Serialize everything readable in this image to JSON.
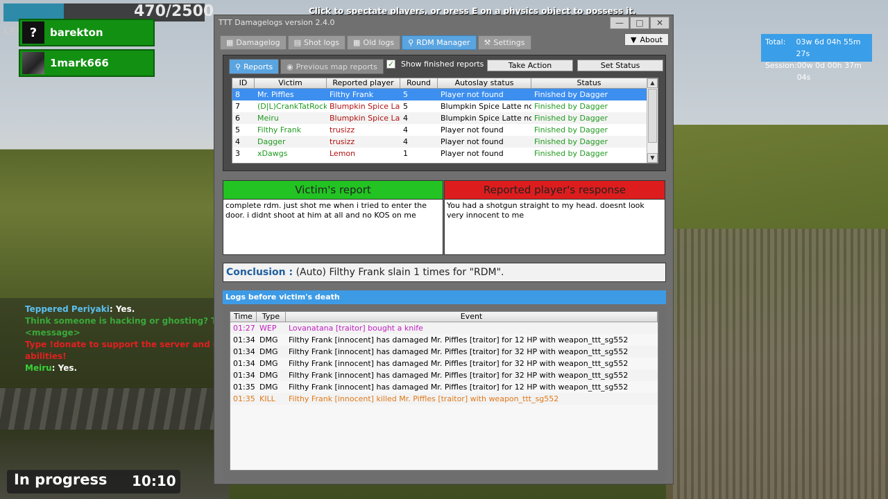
{
  "hud": {
    "ammo": "470/2500",
    "level_label": "LEV",
    "spectate_msg": "Click to spectate players, or press E on a physics object to possess it.",
    "health_fraction": 0.3
  },
  "players": [
    {
      "name": "barekton",
      "avatar": "?"
    },
    {
      "name": "1mark666",
      "avatar": ""
    }
  ],
  "chat": [
    {
      "name": "Teppered Periyaki",
      "name_color": "#5bc0f0",
      "text": ": Yes.",
      "text_color": "#ffffff"
    },
    {
      "name": "",
      "name_color": "#3aa83a",
      "text": "Think someone is hacking or ghosting? Ty",
      "text_color": "#3aa83a"
    },
    {
      "name": "",
      "name_color": "#3aa83a",
      "text": "<message>",
      "text_color": "#3aa83a"
    },
    {
      "name": "",
      "name_color": "#e02020",
      "text": "Type !donate to support the server and g",
      "text_color": "#e02020"
    },
    {
      "name": "",
      "name_color": "#e02020",
      "text": "abilities!",
      "text_color": "#e02020"
    },
    {
      "name": "Meiru",
      "name_color": "#3ad03a",
      "text": ": Yes.",
      "text_color": "#ffffff"
    }
  ],
  "round": {
    "state": "In progress",
    "timer": "10:10"
  },
  "timebox": {
    "total_label": "Total:",
    "total": "03w 6d 04h 55m 27s",
    "session_label": "Session:",
    "session": "00w 0d 00h 37m 04s"
  },
  "window": {
    "title": "TTT Damagelogs version 2.4.0",
    "about": "About",
    "tabs": [
      {
        "label": "Damagelog",
        "icon": "table-icon"
      },
      {
        "label": "Shot logs",
        "icon": "document-icon"
      },
      {
        "label": "Old logs",
        "icon": "calendar-icon"
      },
      {
        "label": "RDM Manager",
        "icon": "magnifier-icon"
      },
      {
        "label": "Settings",
        "icon": "wrench-icon"
      }
    ],
    "active_tab": 3
  },
  "rdm": {
    "subtabs": [
      "Reports",
      "Previous map reports"
    ],
    "show_finished": "Show finished reports",
    "take_action": "Take Action",
    "set_status": "Set Status",
    "columns": [
      "ID",
      "Victim",
      "Reported player",
      "Round",
      "Autoslay status",
      "Status"
    ],
    "rows": [
      {
        "id": "8",
        "victim": "Mr. Piffles",
        "reported": "Filthy Frank",
        "round": "5",
        "autoslay": "Player not found",
        "status": "Finished by Dagger",
        "selected": true
      },
      {
        "id": "7",
        "victim": "(D|L)CrankTatRock",
        "reported": "Blumpkin Spice Latte",
        "round": "5",
        "autoslay": "Blumpkin Spice Latte not...",
        "status": "Finished by Dagger"
      },
      {
        "id": "6",
        "victim": "Meiru",
        "reported": "Blumpkin Spice Latte",
        "round": "4",
        "autoslay": "Blumpkin Spice Latte not...",
        "status": "Finished by Dagger"
      },
      {
        "id": "5",
        "victim": "Filthy Frank",
        "reported": "trusizz",
        "round": "4",
        "autoslay": "Player not found",
        "status": "Finished by Dagger"
      },
      {
        "id": "4",
        "victim": "Dagger",
        "reported": "trusizz",
        "round": "4",
        "autoslay": "Player not found",
        "status": "Finished by Dagger"
      },
      {
        "id": "3",
        "victim": "xDawgs",
        "reported": "Lemon",
        "round": "1",
        "autoslay": "Player not found",
        "status": "Finished by Dagger"
      }
    ],
    "victim_report_title": "Victim's report",
    "victim_report": "complete rdm. just shot me when i tried to enter the door. i didnt shoot at him at all and no KOS on me",
    "response_title": "Reported player's response",
    "response": "You had a shotgun straight to my head. doesnt look very innocent to me",
    "conclusion_label": "Conclusion :",
    "conclusion": "(Auto) Filthy Frank slain 1 times for \"RDM\".",
    "logs_title": "Logs before victim's death",
    "log_columns": [
      "Time",
      "Type",
      "Event"
    ],
    "logs": [
      {
        "time": "01:27",
        "type": "WEP",
        "event": "Lovanatana [traitor] bought a knife",
        "color": "#c020c0"
      },
      {
        "time": "01:34",
        "type": "DMG",
        "event": "Filthy Frank [innocent] has damaged Mr. Piffles [traitor] for 12 HP with weapon_ttt_sg552",
        "color": "#000000"
      },
      {
        "time": "01:34",
        "type": "DMG",
        "event": "Filthy Frank [innocent] has damaged Mr. Piffles [traitor] for 32 HP with weapon_ttt_sg552",
        "color": "#000000"
      },
      {
        "time": "01:34",
        "type": "DMG",
        "event": "Filthy Frank [innocent] has damaged Mr. Piffles [traitor] for 32 HP with weapon_ttt_sg552",
        "color": "#000000"
      },
      {
        "time": "01:34",
        "type": "DMG",
        "event": "Filthy Frank [innocent] has damaged Mr. Piffles [traitor] for 32 HP with weapon_ttt_sg552",
        "color": "#000000"
      },
      {
        "time": "01:35",
        "type": "DMG",
        "event": "Filthy Frank [innocent] has damaged Mr. Piffles [traitor] for 12 HP with weapon_ttt_sg552",
        "color": "#000000"
      },
      {
        "time": "01:35",
        "type": "KILL",
        "event": "Filthy Frank [innocent] killed Mr. Piffles [traitor] with weapon_ttt_sg552",
        "color": "#e07818"
      }
    ]
  }
}
